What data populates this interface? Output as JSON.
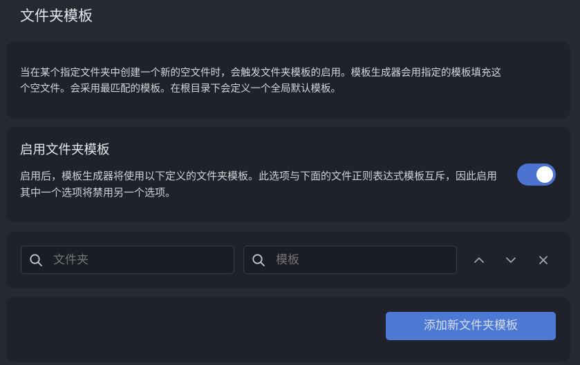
{
  "page": {
    "title": "文件夹模板"
  },
  "description": {
    "text": "当在某个指定文件夹中创建一个新的空文件时，会触发文件夹模板的启用。模板生成器会用指定的模板填充这个空文件。会采用最匹配的模板。在根目录下会定义一个全局默认模板。"
  },
  "setting": {
    "name": "启用文件夹模板",
    "description": "启用后，模板生成器将使用以下定义的文件夹模板。此选项与下面的文件正则表达式模板互斥，因此启用其中一个选项将禁用另一个选项。",
    "toggle_on": true
  },
  "template_row": {
    "folder_placeholder": "文件夹",
    "template_placeholder": "模板",
    "icons": {
      "search": "search-icon",
      "up": "chevron-up-icon",
      "down": "chevron-down-icon",
      "remove": "close-icon"
    }
  },
  "actions": {
    "add_label": "添加新文件夹模板"
  },
  "colors": {
    "accent": "#4b73cf",
    "background": "#262932",
    "card": "#1f222a"
  }
}
